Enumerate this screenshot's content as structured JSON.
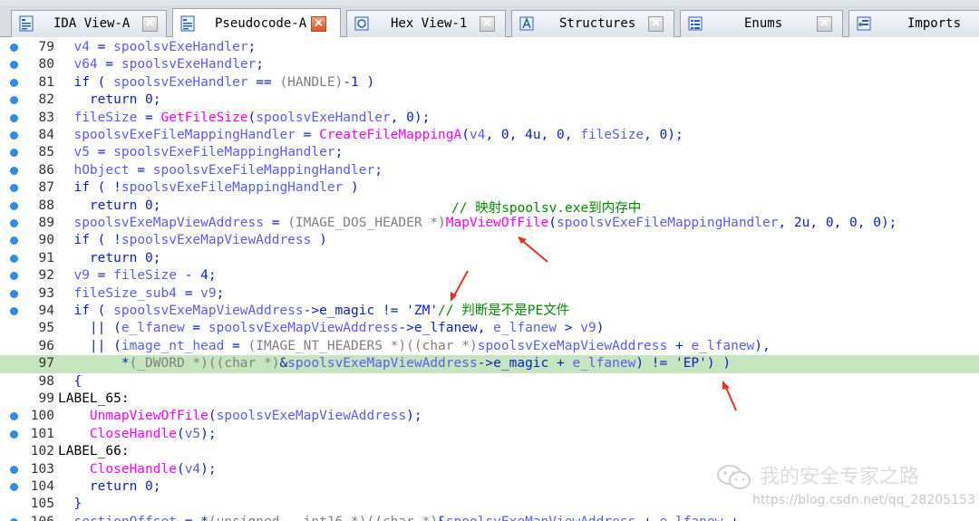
{
  "tabs": [
    {
      "label": "IDA View-A",
      "icon": "ida-view-icon",
      "active": false
    },
    {
      "label": "Pseudocode-A",
      "icon": "pseudocode-icon",
      "active": true
    },
    {
      "label": "Hex View-1",
      "icon": "hex-view-icon",
      "active": false
    },
    {
      "label": "Structures",
      "icon": "structures-icon",
      "active": false
    },
    {
      "label": "Enums",
      "icon": "enums-icon",
      "active": false
    },
    {
      "label": "Imports",
      "icon": "imports-icon",
      "active": false
    }
  ],
  "close_glyph": "×",
  "lines": [
    {
      "n": "79",
      "bp": true,
      "indent": "  ",
      "segs": [
        [
          "id",
          "v4"
        ],
        [
          "k",
          " = "
        ],
        [
          "id",
          "spoolsvExeHandler"
        ],
        [
          "k",
          ";"
        ]
      ]
    },
    {
      "n": "80",
      "bp": true,
      "indent": "  ",
      "segs": [
        [
          "id",
          "v64"
        ],
        [
          "k",
          " = "
        ],
        [
          "id",
          "spoolsvExeHandler"
        ],
        [
          "k",
          ";"
        ]
      ]
    },
    {
      "n": "81",
      "bp": true,
      "indent": "  ",
      "segs": [
        [
          "k",
          "if ( "
        ],
        [
          "id",
          "spoolsvExeHandler"
        ],
        [
          "k",
          " == "
        ],
        [
          "g",
          "(HANDLE)"
        ],
        [
          "k",
          "-1 )"
        ]
      ]
    },
    {
      "n": "82",
      "bp": true,
      "indent": "    ",
      "segs": [
        [
          "k",
          "return 0;"
        ]
      ]
    },
    {
      "n": "83",
      "bp": true,
      "indent": "  ",
      "segs": [
        [
          "id",
          "fileSize"
        ],
        [
          "k",
          " = "
        ],
        [
          "f",
          "GetFileSize"
        ],
        [
          "k",
          "("
        ],
        [
          "id",
          "spoolsvExeHandler"
        ],
        [
          "k",
          ", 0);"
        ]
      ]
    },
    {
      "n": "84",
      "bp": true,
      "indent": "  ",
      "segs": [
        [
          "id",
          "spoolsvExeFileMappingHandler"
        ],
        [
          "k",
          " = "
        ],
        [
          "f",
          "CreateFileMappingA"
        ],
        [
          "k",
          "("
        ],
        [
          "id",
          "v4"
        ],
        [
          "k",
          ", 0, 4u, 0, "
        ],
        [
          "id",
          "fileSize"
        ],
        [
          "k",
          ", 0);"
        ]
      ]
    },
    {
      "n": "85",
      "bp": true,
      "indent": "  ",
      "segs": [
        [
          "id",
          "v5"
        ],
        [
          "k",
          " = "
        ],
        [
          "id",
          "spoolsvExeFileMappingHandler"
        ],
        [
          "k",
          ";"
        ]
      ]
    },
    {
      "n": "86",
      "bp": true,
      "indent": "  ",
      "segs": [
        [
          "id",
          "hObject"
        ],
        [
          "k",
          " = "
        ],
        [
          "id",
          "spoolsvExeFileMappingHandler"
        ],
        [
          "k",
          ";"
        ]
      ]
    },
    {
      "n": "87",
      "bp": true,
      "indent": "  ",
      "segs": [
        [
          "k",
          "if ( !"
        ],
        [
          "id",
          "spoolsvExeFileMappingHandler"
        ],
        [
          "k",
          " )"
        ]
      ]
    },
    {
      "n": "88",
      "bp": true,
      "indent": "    ",
      "segs": [
        [
          "k",
          "return 0;"
        ]
      ]
    },
    {
      "n": "89",
      "bp": true,
      "indent": "  ",
      "segs": [
        [
          "id",
          "spoolsvExeMapViewAddress"
        ],
        [
          "k",
          " = "
        ],
        [
          "g",
          "(IMAGE_DOS_HEADER *)"
        ],
        [
          "f",
          "MapViewOfFile"
        ],
        [
          "k",
          "("
        ],
        [
          "id",
          "spoolsvExeFileMappingHandler"
        ],
        [
          "k",
          ", 2u, 0, 0, 0);"
        ]
      ]
    },
    {
      "n": "90",
      "bp": true,
      "indent": "  ",
      "segs": [
        [
          "k",
          "if ( !"
        ],
        [
          "id",
          "spoolsvExeMapViewAddress"
        ],
        [
          "k",
          " )"
        ]
      ]
    },
    {
      "n": "91",
      "bp": true,
      "indent": "    ",
      "segs": [
        [
          "k",
          "return 0;"
        ]
      ]
    },
    {
      "n": "92",
      "bp": true,
      "indent": "  ",
      "segs": [
        [
          "id",
          "v9"
        ],
        [
          "k",
          " = "
        ],
        [
          "id",
          "fileSize"
        ],
        [
          "k",
          " - 4;"
        ]
      ]
    },
    {
      "n": "93",
      "bp": true,
      "indent": "  ",
      "segs": [
        [
          "id",
          "fileSize_sub4"
        ],
        [
          "k",
          " = "
        ],
        [
          "id",
          "v9"
        ],
        [
          "k",
          ";"
        ]
      ]
    },
    {
      "n": "94",
      "bp": true,
      "indent": "  ",
      "segs": [
        [
          "k",
          "if ( "
        ],
        [
          "id",
          "spoolsvExeMapViewAddress"
        ],
        [
          "k",
          "->e_magic != 'ZM'"
        ],
        [
          "c",
          "// 判断是不是PE文件"
        ]
      ]
    },
    {
      "n": "95",
      "bp": false,
      "indent": "    ",
      "segs": [
        [
          "k",
          "|| ("
        ],
        [
          "id",
          "e_lfanew"
        ],
        [
          "k",
          " = "
        ],
        [
          "id",
          "spoolsvExeMapViewAddress"
        ],
        [
          "k",
          "->e_lfanew, "
        ],
        [
          "id",
          "e_lfanew"
        ],
        [
          "k",
          " > "
        ],
        [
          "id",
          "v9"
        ],
        [
          "k",
          ")"
        ]
      ]
    },
    {
      "n": "96",
      "bp": false,
      "indent": "    ",
      "segs": [
        [
          "k",
          "|| ("
        ],
        [
          "id",
          "image_nt_head"
        ],
        [
          "k",
          " = "
        ],
        [
          "g",
          "(IMAGE_NT_HEADERS *)((char *)"
        ],
        [
          "id",
          "spoolsvExeMapViewAddress"
        ],
        [
          "k",
          " + "
        ],
        [
          "id",
          "e_lfanew"
        ],
        [
          "k",
          "),"
        ]
      ]
    },
    {
      "n": "97",
      "bp": false,
      "hl": true,
      "indent": "        ",
      "segs": [
        [
          "k",
          "*"
        ],
        [
          "g",
          "(_DWORD *)((char *)"
        ],
        [
          "k",
          "&"
        ],
        [
          "id",
          "spoolsvExeMapViewAddress"
        ],
        [
          "k",
          "->e_magic + "
        ],
        [
          "id",
          "e_lfanew"
        ],
        [
          "k",
          ") != 'EP') )"
        ]
      ]
    },
    {
      "n": "98",
      "bp": false,
      "indent": "  ",
      "segs": [
        [
          "k",
          "{"
        ]
      ]
    },
    {
      "n": "99",
      "bp": false,
      "indent": "",
      "segs": [
        [
          "l",
          "LABEL_65:"
        ]
      ]
    },
    {
      "n": "100",
      "bp": true,
      "indent": "    ",
      "segs": [
        [
          "f",
          "UnmapViewOfFile"
        ],
        [
          "k",
          "("
        ],
        [
          "id",
          "spoolsvExeMapViewAddress"
        ],
        [
          "k",
          ");"
        ]
      ]
    },
    {
      "n": "101",
      "bp": true,
      "indent": "    ",
      "segs": [
        [
          "f",
          "CloseHandle"
        ],
        [
          "k",
          "("
        ],
        [
          "id",
          "v5"
        ],
        [
          "k",
          ");"
        ]
      ]
    },
    {
      "n": "102",
      "bp": false,
      "indent": "",
      "segs": [
        [
          "l",
          "LABEL_66:"
        ]
      ]
    },
    {
      "n": "103",
      "bp": true,
      "indent": "    ",
      "segs": [
        [
          "f",
          "CloseHandle"
        ],
        [
          "k",
          "("
        ],
        [
          "id",
          "v4"
        ],
        [
          "k",
          ");"
        ]
      ]
    },
    {
      "n": "104",
      "bp": true,
      "indent": "    ",
      "segs": [
        [
          "k",
          "return 0;"
        ]
      ]
    },
    {
      "n": "105",
      "bp": false,
      "indent": "  ",
      "segs": [
        [
          "k",
          "}"
        ]
      ]
    },
    {
      "n": "106",
      "bp": true,
      "indent": "  ",
      "segs": [
        [
          "id",
          "sectionOffset"
        ],
        [
          "k",
          " = *"
        ],
        [
          "g",
          "(unsigned __int16 *)((char *)"
        ],
        [
          "k",
          "&"
        ],
        [
          "id",
          "spoolsvExeMapViewAddress"
        ],
        [
          "k",
          " + "
        ],
        [
          "id",
          "e_lfanew"
        ],
        [
          "k",
          " + ..."
        ]
      ]
    }
  ],
  "annotation_89": "// 映射spoolsv.exe到内存中",
  "watermark": {
    "title": "我的安全专家之路",
    "url": "https://blog.csdn.net/qq_28205153",
    "icon": "wechat-icon"
  },
  "colors": {
    "keyword": "#0a1fc4",
    "identifier": "#5b5cf6",
    "function": "#ff00ff",
    "cast": "#808080",
    "comment": "#008a00",
    "highlight": "#c6e4be",
    "breakpoint": "#2f8be6",
    "arrow": "#e8321e"
  }
}
